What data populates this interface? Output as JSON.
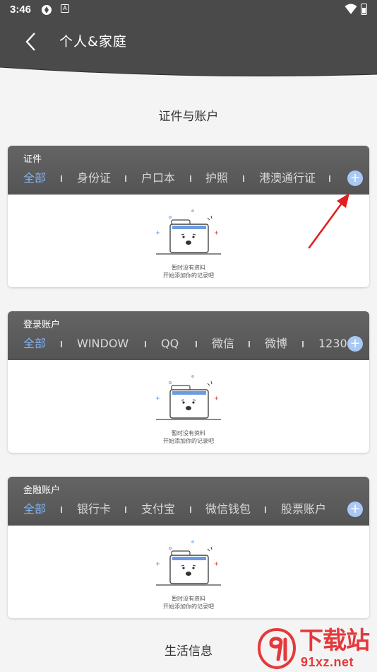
{
  "status_bar": {
    "time": "3:46",
    "notification_badge": "A"
  },
  "header": {
    "title": "个人&家庭"
  },
  "sections": [
    {
      "title": "证件与账户"
    },
    {
      "title": "生活信息"
    }
  ],
  "cards": [
    {
      "title": "证件",
      "tabs": [
        "全部",
        "身份证",
        "户口本",
        "护照",
        "港澳通行证"
      ],
      "active_tab": "全部",
      "add_label": "+",
      "empty_line1": "暂时没有资料",
      "empty_line2": "开始添加你的记录吧"
    },
    {
      "title": "登录账户",
      "tabs": [
        "全部",
        "WINDOW",
        "QQ",
        "微信",
        "微博",
        "1230"
      ],
      "active_tab": "全部",
      "add_label": "+",
      "empty_line1": "暂时没有资料",
      "empty_line2": "开始添加你的记录吧"
    },
    {
      "title": "金融账户",
      "tabs": [
        "全部",
        "银行卡",
        "支付宝",
        "微信钱包",
        "股票账户"
      ],
      "active_tab": "全部",
      "add_label": "+",
      "empty_line1": "暂时没有资料",
      "empty_line2": "开始添加你的记录吧"
    }
  ],
  "watermark": {
    "brand": "下载站",
    "domain": "91xz.net"
  },
  "colors": {
    "header_bg": "#4a4a4a",
    "card_head_bg": "#5c5c5c",
    "active_tab": "#7fb2f2",
    "add_button": "#a9c8f5",
    "annotation_arrow": "#e02020",
    "watermark": "#e4393c"
  },
  "icons": [
    "back-icon",
    "wifi-icon",
    "battery-icon",
    "add-icon",
    "empty-folder-icon",
    "annotation-arrow"
  ]
}
